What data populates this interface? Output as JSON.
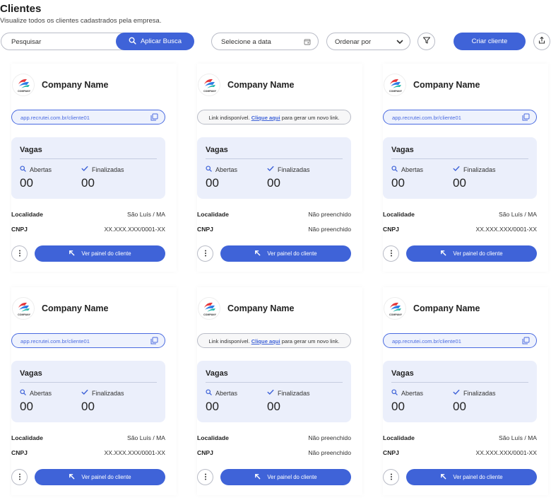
{
  "header": {
    "title": "Clientes",
    "subtitle": "Visualize todos os clientes cadastrados pela empresa."
  },
  "toolbar": {
    "search_placeholder": "Pesquisar",
    "search_button": "Aplicar Busca",
    "date_placeholder": "Selecione a data",
    "sort_label": "Ordenar por",
    "create_button": "Criar cliente"
  },
  "colors": {
    "primary": "#3f63d8",
    "panel_bg": "#ebeffb"
  },
  "cards": [
    {
      "name": "Company Name",
      "logo_caption": "COMPANY",
      "link_available": true,
      "link_url": "app.recrutei.com.br/cliente01",
      "link_unavailable_prefix": "",
      "link_unavailable_action": "",
      "link_unavailable_suffix": "",
      "vagas_title": "Vagas",
      "abertas_label": "Abertas",
      "abertas_value": "00",
      "finalizadas_label": "Finalizadas",
      "finalizadas_value": "00",
      "localidade_label": "Localidade",
      "localidade_value": "São Luís / MA",
      "cnpj_label": "CNPJ",
      "cnpj_value": "XX.XXX.XXX/0001-XX",
      "panel_button": "Ver painel do cliente"
    },
    {
      "name": "Company Name",
      "logo_caption": "COMPANY",
      "link_available": false,
      "link_url": "",
      "link_unavailable_prefix": "Link indisponível.",
      "link_unavailable_action": "Clique aqui",
      "link_unavailable_suffix": "para gerar um novo link.",
      "vagas_title": "Vagas",
      "abertas_label": "Abertas",
      "abertas_value": "00",
      "finalizadas_label": "Finalizadas",
      "finalizadas_value": "00",
      "localidade_label": "Localidade",
      "localidade_value": "Não preenchido",
      "cnpj_label": "CNPJ",
      "cnpj_value": "Não preenchido",
      "panel_button": "Ver painel do cliente"
    },
    {
      "name": "Company Name",
      "logo_caption": "COMPANY",
      "link_available": true,
      "link_url": "app.recrutei.com.br/cliente01",
      "link_unavailable_prefix": "",
      "link_unavailable_action": "",
      "link_unavailable_suffix": "",
      "vagas_title": "Vagas",
      "abertas_label": "Abertas",
      "abertas_value": "00",
      "finalizadas_label": "Finalizadas",
      "finalizadas_value": "00",
      "localidade_label": "Localidade",
      "localidade_value": "São Luís / MA",
      "cnpj_label": "CNPJ",
      "cnpj_value": "XX.XXX.XXX/0001-XX",
      "panel_button": "Ver painel do cliente"
    },
    {
      "name": "Company Name",
      "logo_caption": "COMPANY",
      "link_available": true,
      "link_url": "app.recrutei.com.br/cliente01",
      "link_unavailable_prefix": "",
      "link_unavailable_action": "",
      "link_unavailable_suffix": "",
      "vagas_title": "Vagas",
      "abertas_label": "Abertas",
      "abertas_value": "00",
      "finalizadas_label": "Finalizadas",
      "finalizadas_value": "00",
      "localidade_label": "Localidade",
      "localidade_value": "São Luís / MA",
      "cnpj_label": "CNPJ",
      "cnpj_value": "XX.XXX.XXX/0001-XX",
      "panel_button": "Ver painel do cliente"
    },
    {
      "name": "Company Name",
      "logo_caption": "COMPANY",
      "link_available": false,
      "link_url": "",
      "link_unavailable_prefix": "Link indisponível.",
      "link_unavailable_action": "Clique aqui",
      "link_unavailable_suffix": "para gerar um novo link.",
      "vagas_title": "Vagas",
      "abertas_label": "Abertas",
      "abertas_value": "00",
      "finalizadas_label": "Finalizadas",
      "finalizadas_value": "00",
      "localidade_label": "Localidade",
      "localidade_value": "Não preenchido",
      "cnpj_label": "CNPJ",
      "cnpj_value": "Não preenchido",
      "panel_button": "Ver painel do cliente"
    },
    {
      "name": "Company Name",
      "logo_caption": "COMPANY",
      "link_available": true,
      "link_url": "app.recrutei.com.br/cliente01",
      "link_unavailable_prefix": "",
      "link_unavailable_action": "",
      "link_unavailable_suffix": "",
      "vagas_title": "Vagas",
      "abertas_label": "Abertas",
      "abertas_value": "00",
      "finalizadas_label": "Finalizadas",
      "finalizadas_value": "00",
      "localidade_label": "Localidade",
      "localidade_value": "São Luís / MA",
      "cnpj_label": "CNPJ",
      "cnpj_value": "XX.XXX.XXX/0001-XX",
      "panel_button": "Ver painel do cliente"
    }
  ]
}
